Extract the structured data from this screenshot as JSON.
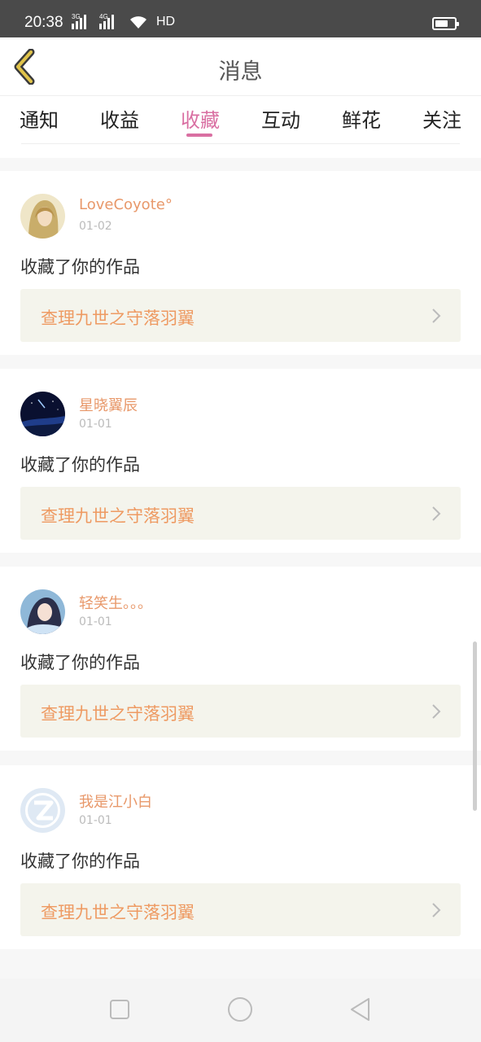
{
  "status_bar": {
    "time": "20:38",
    "signal1_label": "3G",
    "signal2_label": "4G",
    "hd_label": "HD",
    "icons": [
      "signal-icon",
      "signal-icon",
      "wifi-icon",
      "battery-icon"
    ]
  },
  "header": {
    "title": "消息",
    "back_icon": "chevron-left-icon",
    "accent_color": "#e0c34a"
  },
  "tabs": [
    {
      "label": "通知",
      "active": false
    },
    {
      "label": "收益",
      "active": false
    },
    {
      "label": "收藏",
      "active": true
    },
    {
      "label": "互动",
      "active": false
    },
    {
      "label": "鲜花",
      "active": false
    },
    {
      "label": "关注",
      "active": false
    }
  ],
  "colors": {
    "tab_active": "#d96fa2",
    "username": "#e8986a",
    "work_title": "#ee9a62",
    "work_bg": "#f4f4ec"
  },
  "notifications": [
    {
      "username": "LoveCoyote°",
      "date": "01-02",
      "action": "收藏了你的作品",
      "work_title": "查理九世之守落羽翼"
    },
    {
      "username": "星晓翼辰",
      "date": "01-01",
      "action": "收藏了你的作品",
      "work_title": "查理九世之守落羽翼"
    },
    {
      "username": "轻笑生。。。",
      "date": "01-01",
      "action": "收藏了你的作品",
      "work_title": "查理九世之守落羽翼"
    },
    {
      "username": "我是江小白",
      "date": "01-01",
      "action": "收藏了你的作品",
      "work_title": "查理九世之守落羽翼"
    }
  ],
  "nav_bar": {
    "icons": [
      "square-icon",
      "circle-icon",
      "triangle-back-icon"
    ]
  }
}
